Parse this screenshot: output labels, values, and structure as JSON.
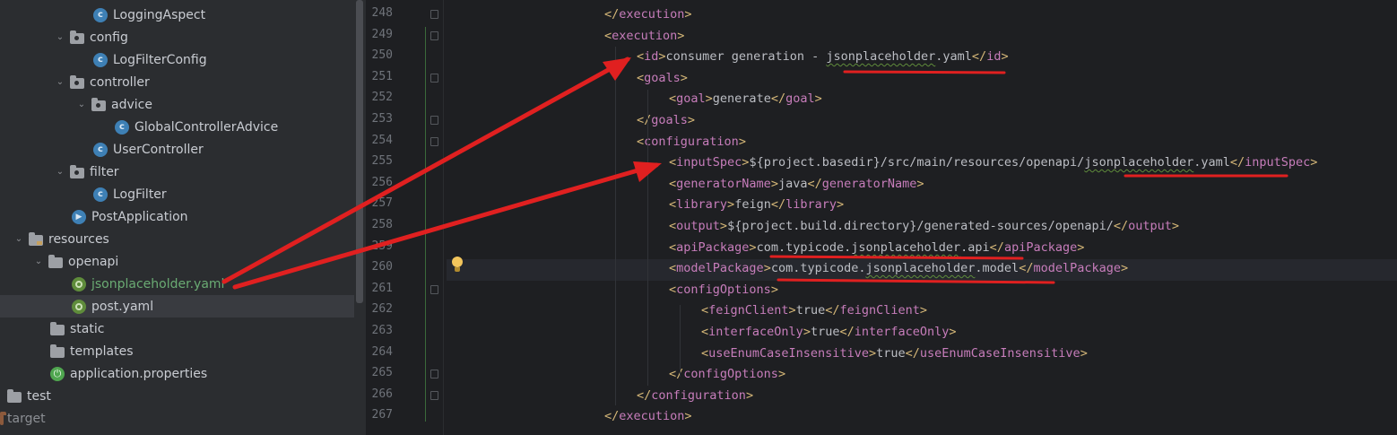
{
  "project_tree": {
    "items": [
      {
        "label": "LoggingAspect",
        "icon": "java-class-icon"
      },
      {
        "label": "config",
        "icon": "package-folder-icon"
      },
      {
        "label": "LogFilterConfig",
        "icon": "java-class-icon"
      },
      {
        "label": "controller",
        "icon": "package-folder-icon"
      },
      {
        "label": "advice",
        "icon": "package-folder-icon"
      },
      {
        "label": "GlobalControllerAdvice",
        "icon": "java-class-icon"
      },
      {
        "label": "UserController",
        "icon": "java-class-icon"
      },
      {
        "label": "filter",
        "icon": "package-folder-icon"
      },
      {
        "label": "LogFilter",
        "icon": "java-class-icon"
      },
      {
        "label": "PostApplication",
        "icon": "spring-boot-class-icon"
      },
      {
        "label": "resources",
        "icon": "resources-folder-icon"
      },
      {
        "label": "openapi",
        "icon": "folder-icon"
      },
      {
        "label": "jsonplaceholder.yaml",
        "icon": "openapi-yaml-icon"
      },
      {
        "label": "post.yaml",
        "icon": "openapi-yaml-icon"
      },
      {
        "label": "static",
        "icon": "folder-icon"
      },
      {
        "label": "templates",
        "icon": "folder-icon"
      },
      {
        "label": "application.properties",
        "icon": "spring-properties-icon"
      },
      {
        "label": "test",
        "icon": "folder-icon"
      },
      {
        "label": "target",
        "icon": "excluded-folder-icon"
      }
    ]
  },
  "editor": {
    "line_numbers": [
      "248",
      "249",
      "250",
      "251",
      "252",
      "253",
      "254",
      "255",
      "256",
      "257",
      "258",
      "259",
      "260",
      "261",
      "262",
      "263",
      "264",
      "265",
      "266",
      "267"
    ],
    "lines": [
      {
        "tag_open": "</",
        "tag": "execution",
        "tag_close": ">",
        "text": "",
        "tag2_open": "",
        "tag2": "",
        "tag2_close": ""
      },
      {
        "tag_open": "<",
        "tag": "execution",
        "tag_close": ">",
        "text": "",
        "tag2_open": "",
        "tag2": "",
        "tag2_close": ""
      },
      {
        "tag_open": "<",
        "tag": "id",
        "tag_close": ">",
        "text": "consumer generation - jsonplaceholder.yaml",
        "tag2_open": "</",
        "tag2": "id",
        "tag2_close": ">"
      },
      {
        "tag_open": "<",
        "tag": "goals",
        "tag_close": ">",
        "text": "",
        "tag2_open": "",
        "tag2": "",
        "tag2_close": ""
      },
      {
        "tag_open": "<",
        "tag": "goal",
        "tag_close": ">",
        "text": "generate",
        "tag2_open": "</",
        "tag2": "goal",
        "tag2_close": ">"
      },
      {
        "tag_open": "</",
        "tag": "goals",
        "tag_close": ">",
        "text": "",
        "tag2_open": "",
        "tag2": "",
        "tag2_close": ""
      },
      {
        "tag_open": "<",
        "tag": "configuration",
        "tag_close": ">",
        "text": "",
        "tag2_open": "",
        "tag2": "",
        "tag2_close": ""
      },
      {
        "tag_open": "<",
        "tag": "inputSpec",
        "tag_close": ">",
        "text": "${project.basedir}/src/main/resources/openapi/jsonplaceholder.yaml",
        "tag2_open": "</",
        "tag2": "inputSpec",
        "tag2_close": ">"
      },
      {
        "tag_open": "<",
        "tag": "generatorName",
        "tag_close": ">",
        "text": "java",
        "tag2_open": "</",
        "tag2": "generatorName",
        "tag2_close": ">"
      },
      {
        "tag_open": "<",
        "tag": "library",
        "tag_close": ">",
        "text": "feign",
        "tag2_open": "</",
        "tag2": "library",
        "tag2_close": ">"
      },
      {
        "tag_open": "<",
        "tag": "output",
        "tag_close": ">",
        "text": "${project.build.directory}/generated-sources/openapi/",
        "tag2_open": "</",
        "tag2": "output",
        "tag2_close": ">"
      },
      {
        "tag_open": "<",
        "tag": "apiPackage",
        "tag_close": ">",
        "text": "com.typicode.jsonplaceholder.api",
        "tag2_open": "</",
        "tag2": "apiPackage",
        "tag2_close": ">"
      },
      {
        "tag_open": "<",
        "tag": "modelPackage",
        "tag_close": ">",
        "text": "com.typicode.jsonplaceholder.model",
        "tag2_open": "</",
        "tag2": "modelPackage",
        "tag2_close": ">"
      },
      {
        "tag_open": "<",
        "tag": "configOptions",
        "tag_close": ">",
        "text": "",
        "tag2_open": "",
        "tag2": "",
        "tag2_close": ""
      },
      {
        "tag_open": "<",
        "tag": "feignClient",
        "tag_close": ">",
        "text": "true",
        "tag2_open": "</",
        "tag2": "feignClient",
        "tag2_close": ">"
      },
      {
        "tag_open": "<",
        "tag": "interfaceOnly",
        "tag_close": ">",
        "text": "true",
        "tag2_open": "</",
        "tag2": "interfaceOnly",
        "tag2_close": ">"
      },
      {
        "tag_open": "<",
        "tag": "useEnumCaseInsensitive",
        "tag_close": ">",
        "text": "true",
        "tag2_open": "</",
        "tag2": "useEnumCaseInsensitive",
        "tag2_close": ">"
      },
      {
        "tag_open": "</",
        "tag": "configOptions",
        "tag_close": ">",
        "text": "",
        "tag2_open": "",
        "tag2": "",
        "tag2_close": ""
      },
      {
        "tag_open": "</",
        "tag": "configuration",
        "tag_close": ">",
        "text": "",
        "tag2_open": "",
        "tag2": "",
        "tag2_close": ""
      },
      {
        "tag_open": "</",
        "tag": "execution",
        "tag_close": ">",
        "text": "",
        "tag2_open": "",
        "tag2": "",
        "tag2_close": ""
      }
    ]
  },
  "colors": {
    "annotation_red": "#e02020",
    "xml_tag": "#d5b778",
    "xml_bracket_tag": "#c77dbb",
    "selected_row": "#2e436e",
    "yaml_label": "#6aab73"
  }
}
